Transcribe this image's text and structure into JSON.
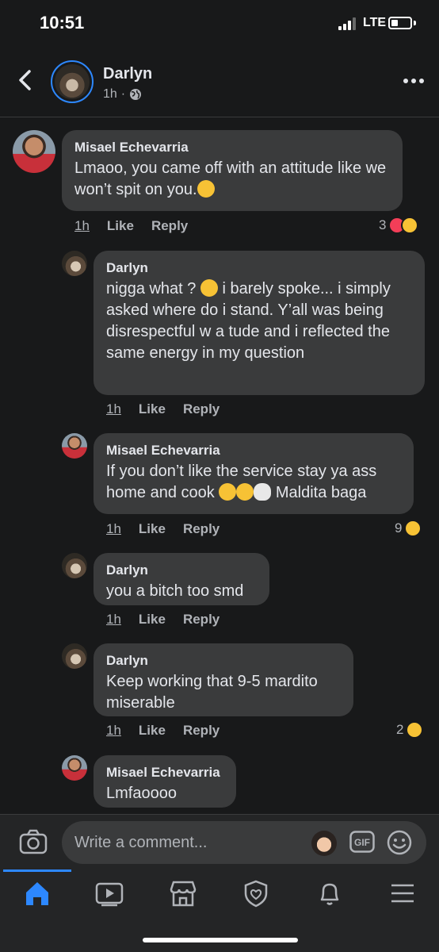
{
  "status_bar": {
    "time": "10:51",
    "network": "LTE",
    "battery_level": 0.35
  },
  "header": {
    "name": "Darlyn",
    "age": "1h",
    "separator": "·",
    "privacy_icon": "globe-icon"
  },
  "comments": [
    {
      "name": "Misael Echevarria",
      "text_before": "Lmaoo, you came off with an attitude like we won’t spit on you.",
      "emoji": [
        "rofl"
      ],
      "time": "1h",
      "like": "Like",
      "reply": "Reply",
      "reactions": {
        "count": "3",
        "types": [
          "heart",
          "haha"
        ]
      }
    },
    {
      "name": "Darlyn",
      "text_before": "nigga what ? ",
      "emoji": [
        "joy"
      ],
      "text_after": " i barely spoke... i simply asked where do i stand. Y’all was being disrespectful w a tude and i reflected the same energy in my question",
      "time": "1h",
      "like": "Like",
      "reply": "Reply"
    },
    {
      "name": "Misael Echevarria",
      "text_before": "If you don’t like the service stay ya ass home and cook ",
      "emoji": [
        "rofl",
        "rofl",
        "skull"
      ],
      "text_after": " Maldita baga",
      "time": "1h",
      "like": "Like",
      "reply": "Reply",
      "reactions": {
        "count": "9",
        "types": [
          "haha"
        ]
      }
    },
    {
      "name": "Darlyn",
      "text_before": "you a bitch too smd",
      "time": "1h",
      "like": "Like",
      "reply": "Reply"
    },
    {
      "name": "Darlyn",
      "text_before": "Keep working that 9-5 mardito miserable",
      "time": "1h",
      "like": "Like",
      "reply": "Reply",
      "reactions": {
        "count": "2",
        "types": [
          "haha"
        ]
      }
    },
    {
      "name": "Misael Echevarria",
      "text_before": "Lmfaoooo"
    }
  ],
  "composer": {
    "placeholder": "Write a comment...",
    "gif_label": "GIF"
  },
  "tabs": [
    "home",
    "watch",
    "marketplace",
    "groups",
    "notifications",
    "menu"
  ],
  "colors": {
    "accent": "#2d88ff",
    "bubble": "#3a3b3c",
    "background": "#18191a",
    "heart": "#f33e58",
    "haha": "#f7c235"
  }
}
